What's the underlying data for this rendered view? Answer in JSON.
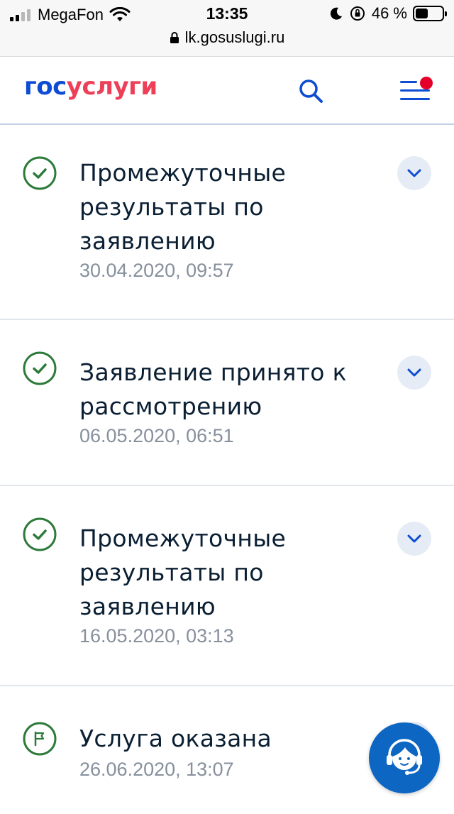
{
  "status_bar": {
    "carrier": "MegaFon",
    "time": "13:35",
    "battery_percent": "46 %",
    "battery_level": 0.46
  },
  "browser": {
    "url": "lk.gosuslugi.ru"
  },
  "header": {
    "logo_part1": "гос",
    "logo_part2": "услуги"
  },
  "timeline": [
    {
      "title": "Промежуточные результаты по заявлению",
      "date": "30.04.2020, 09:57",
      "status": "done"
    },
    {
      "title": "Заявление принято к рассмотрению",
      "date": "06.05.2020, 06:51",
      "status": "done"
    },
    {
      "title": "Промежуточные результаты по заявлению",
      "date": "16.05.2020, 03:13",
      "status": "done"
    },
    {
      "title": "Услуга оказана",
      "date": "26.06.2020, 13:07",
      "status": "final"
    }
  ],
  "colors": {
    "brand_blue": "#0d4cd3",
    "brand_red": "#ee3f58",
    "success_green": "#2d7a3a",
    "support_blue": "#0d66c2"
  }
}
